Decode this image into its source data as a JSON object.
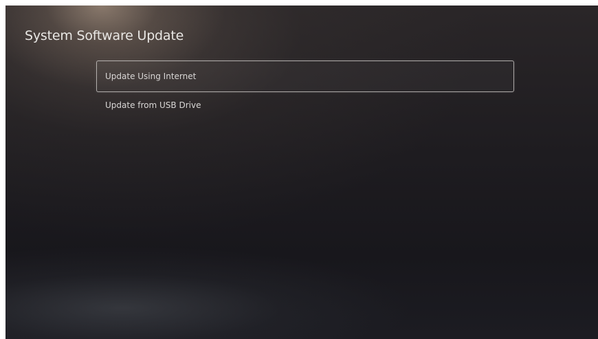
{
  "screen": {
    "title": "System Software Update"
  },
  "menu": {
    "items": [
      {
        "label": "Update Using Internet",
        "focused": true
      },
      {
        "label": "Update from USB Drive",
        "focused": false
      }
    ]
  },
  "colors": {
    "background": "#17161b",
    "text": "#e9e7e4",
    "focus_border": "#c8c4c2"
  }
}
